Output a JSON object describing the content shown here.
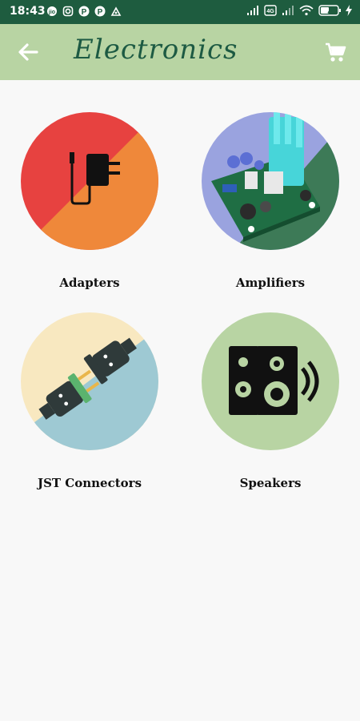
{
  "status_bar": {
    "time": "18:43",
    "notifications": [
      "jio-icon",
      "instagram-icon",
      "paytm-icon",
      "paytm-icon",
      "app-icon"
    ],
    "battery": "43"
  },
  "app_bar": {
    "title": "Electronics",
    "background": "#b8d4a3",
    "title_color": "#1d5a43"
  },
  "categories": [
    {
      "label": "Adapters",
      "icon": "power-adapter-icon"
    },
    {
      "label": "Amplifiers",
      "icon": "amplifier-board-icon"
    },
    {
      "label": "JST Connectors",
      "icon": "plug-connector-icon"
    },
    {
      "label": "Speakers",
      "icon": "speaker-icon"
    }
  ]
}
